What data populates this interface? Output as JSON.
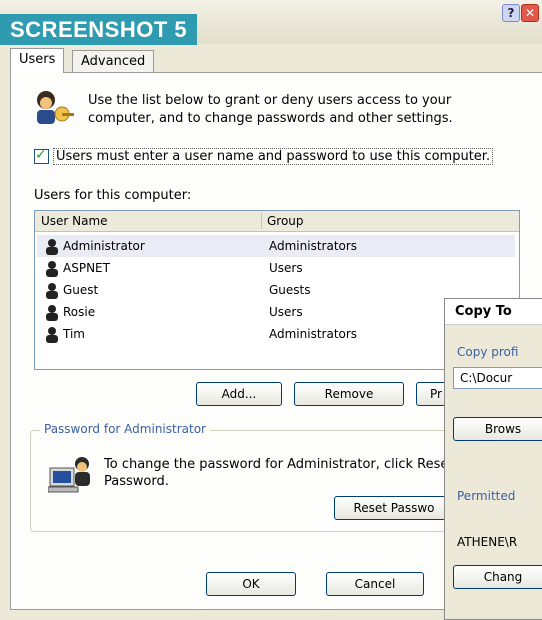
{
  "caption": "SCREENSHOT 5",
  "window": {
    "help_glyph": "?",
    "close_glyph": "✕"
  },
  "tabs": [
    {
      "label": "Users"
    },
    {
      "label": "Advanced"
    }
  ],
  "intro": "Use the list below to grant or deny users access to your computer, and to change passwords and other settings.",
  "require_login": {
    "checked": true,
    "label": "Users must enter a user name and password to use this computer."
  },
  "users_section_label": "Users for this computer:",
  "columns": {
    "user_name": "User Name",
    "group": "Group"
  },
  "users": [
    {
      "name": "Administrator",
      "group": "Administrators",
      "selected": true
    },
    {
      "name": "ASPNET",
      "group": "Users"
    },
    {
      "name": "Guest",
      "group": "Guests"
    },
    {
      "name": "Rosie",
      "group": "Users"
    },
    {
      "name": "Tim",
      "group": "Administrators"
    }
  ],
  "buttons": {
    "add": "Add...",
    "remove": "Remove",
    "properties": "Pr",
    "reset_password": "Reset Passwo",
    "ok": "OK",
    "cancel": "Cancel"
  },
  "password_group": {
    "title": "Password for Administrator",
    "text": "To change the password for Administrator, click Rese Password."
  },
  "copy_to": {
    "title": "Copy To",
    "copy_profile_label": "Copy profi",
    "path_value": "C:\\Docur",
    "browse": "Brows",
    "permitted_label": "Permitted",
    "permitted_value": "ATHENE\\R",
    "change": "Chang"
  },
  "colors": {
    "caption_bg": "#2e9bb1",
    "accent_text": "#3b5fa6",
    "button_border": "#003c74"
  }
}
